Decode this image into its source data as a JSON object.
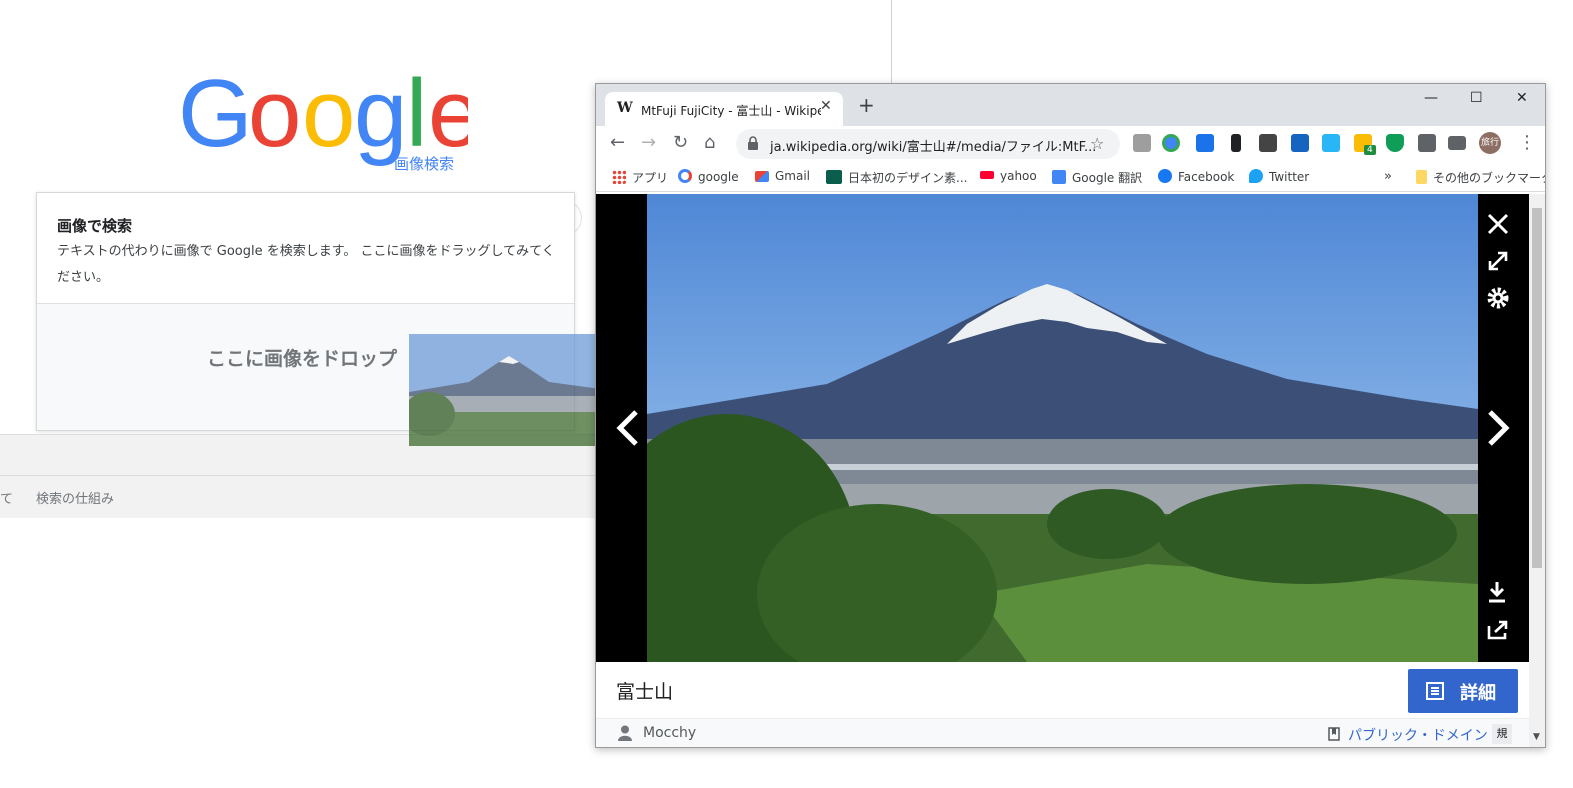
{
  "google_page": {
    "logo_text": "Google",
    "logo_sub": "画像検索",
    "panel_title": "画像で検索",
    "panel_desc": "テキストの代わりに画像で Google を検索します。 ここに画像をドラッグしてみてください。",
    "drop_text": "ここに画像をドロップ",
    "footer_left": "て",
    "footer_how": "検索の仕組み"
  },
  "browser": {
    "tab": {
      "favicon": "W",
      "title": "MtFuji FujiCity - 富士山 - Wikipedia",
      "close": "✕"
    },
    "new_tab": "+",
    "window_controls": {
      "minimize": "—",
      "maximize": "☐",
      "close": "✕"
    },
    "toolbar": {
      "back": "←",
      "forward": "→",
      "reload": "↻",
      "home": "⌂",
      "star": "☆",
      "menu": "⋮",
      "url": "ja.wikipedia.org/wiki/富士山#/media/ファイル:MtF...",
      "extension_badge": "4",
      "avatar": "旅行"
    },
    "bookmarks": [
      {
        "label": "アプリ",
        "icon": "apps-grid-icon"
      },
      {
        "label": "google",
        "icon": "google-icon"
      },
      {
        "label": "Gmail",
        "icon": "gmail-icon"
      },
      {
        "label": "日本初のデザイン素...",
        "icon": "dc-icon"
      },
      {
        "label": "yahoo",
        "icon": "yahoo-icon"
      },
      {
        "label": "Google 翻訳",
        "icon": "translate-icon"
      },
      {
        "label": "Facebook",
        "icon": "facebook-icon"
      },
      {
        "label": "Twitter",
        "icon": "twitter-icon"
      }
    ],
    "bookmarks_overflow": "»",
    "other_bookmarks": "その他のブックマーク"
  },
  "media_viewer": {
    "caption_title": "富士山",
    "details_label": "詳細",
    "author": "Mocchy",
    "license": "パブリック・ドメイン",
    "license_tag": "規"
  },
  "colors": {
    "google_blue": "#4285f4",
    "google_red": "#ea4335",
    "google_yellow": "#fbbc05",
    "google_green": "#34a853",
    "wiki_blue": "#3366cc"
  }
}
